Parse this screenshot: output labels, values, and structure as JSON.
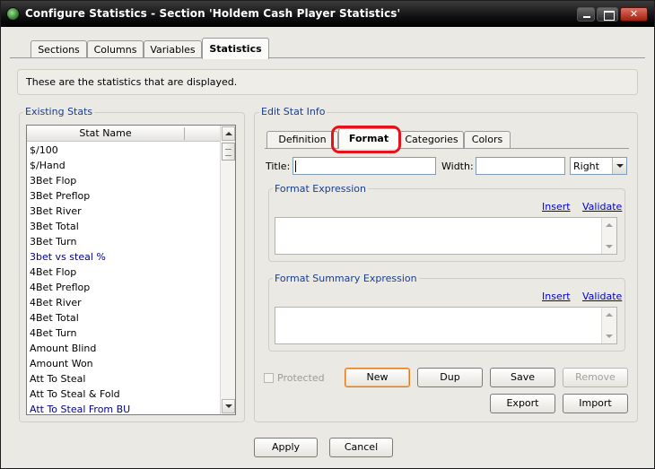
{
  "window": {
    "title": "Configure Statistics - Section 'Holdem Cash Player Statistics'"
  },
  "top_tabs": [
    {
      "label": "Sections"
    },
    {
      "label": "Columns"
    },
    {
      "label": "Variables"
    },
    {
      "label": "Statistics",
      "active": true
    }
  ],
  "description": "These are the statistics that are displayed.",
  "existing_stats": {
    "title": "Existing Stats",
    "column_header": "Stat Name",
    "items": [
      {
        "label": "$/100",
        "color": "#000000"
      },
      {
        "label": "$/Hand",
        "color": "#000000"
      },
      {
        "label": "3Bet Flop",
        "color": "#000000"
      },
      {
        "label": "3Bet Preflop",
        "color": "#000000"
      },
      {
        "label": "3Bet River",
        "color": "#000000"
      },
      {
        "label": "3Bet Total",
        "color": "#000000"
      },
      {
        "label": "3Bet Turn",
        "color": "#000000"
      },
      {
        "label": "3bet vs steal %",
        "color": "#00008c"
      },
      {
        "label": "4Bet Flop",
        "color": "#000000"
      },
      {
        "label": "4Bet Preflop",
        "color": "#000000"
      },
      {
        "label": "4Bet River",
        "color": "#000000"
      },
      {
        "label": "4Bet Total",
        "color": "#000000"
      },
      {
        "label": "4Bet Turn",
        "color": "#000000"
      },
      {
        "label": "Amount Blind",
        "color": "#000000"
      },
      {
        "label": "Amount Won",
        "color": "#000000"
      },
      {
        "label": "Att To Steal",
        "color": "#000000"
      },
      {
        "label": "Att To Steal & Fold",
        "color": "#000000"
      },
      {
        "label": "Att To Steal From BU",
        "color": "#00008c"
      }
    ]
  },
  "edit_info": {
    "title": "Edit Stat Info",
    "tabs": [
      {
        "label": "Definition"
      },
      {
        "label": "Format",
        "active": true
      },
      {
        "label": "Categories"
      },
      {
        "label": "Colors"
      }
    ],
    "title_label": "Title:",
    "title_value": "",
    "width_label": "Width:",
    "width_value": "",
    "align_value": "Right",
    "format_expression": {
      "title": "Format Expression",
      "insert": "Insert",
      "validate": "Validate",
      "value": ""
    },
    "format_summary_expression": {
      "title": "Format Summary Expression",
      "insert": "Insert",
      "validate": "Validate",
      "value": ""
    },
    "protected_label": "Protected",
    "buttons": {
      "new": "New",
      "dup": "Dup",
      "save": "Save",
      "remove": "Remove",
      "export": "Export",
      "import": "Import"
    }
  },
  "footer": {
    "apply": "Apply",
    "cancel": "Cancel"
  },
  "colors": {
    "highlight_ring": "#e4121b",
    "group_title": "#1a3c8c",
    "link": "#0000cc"
  }
}
